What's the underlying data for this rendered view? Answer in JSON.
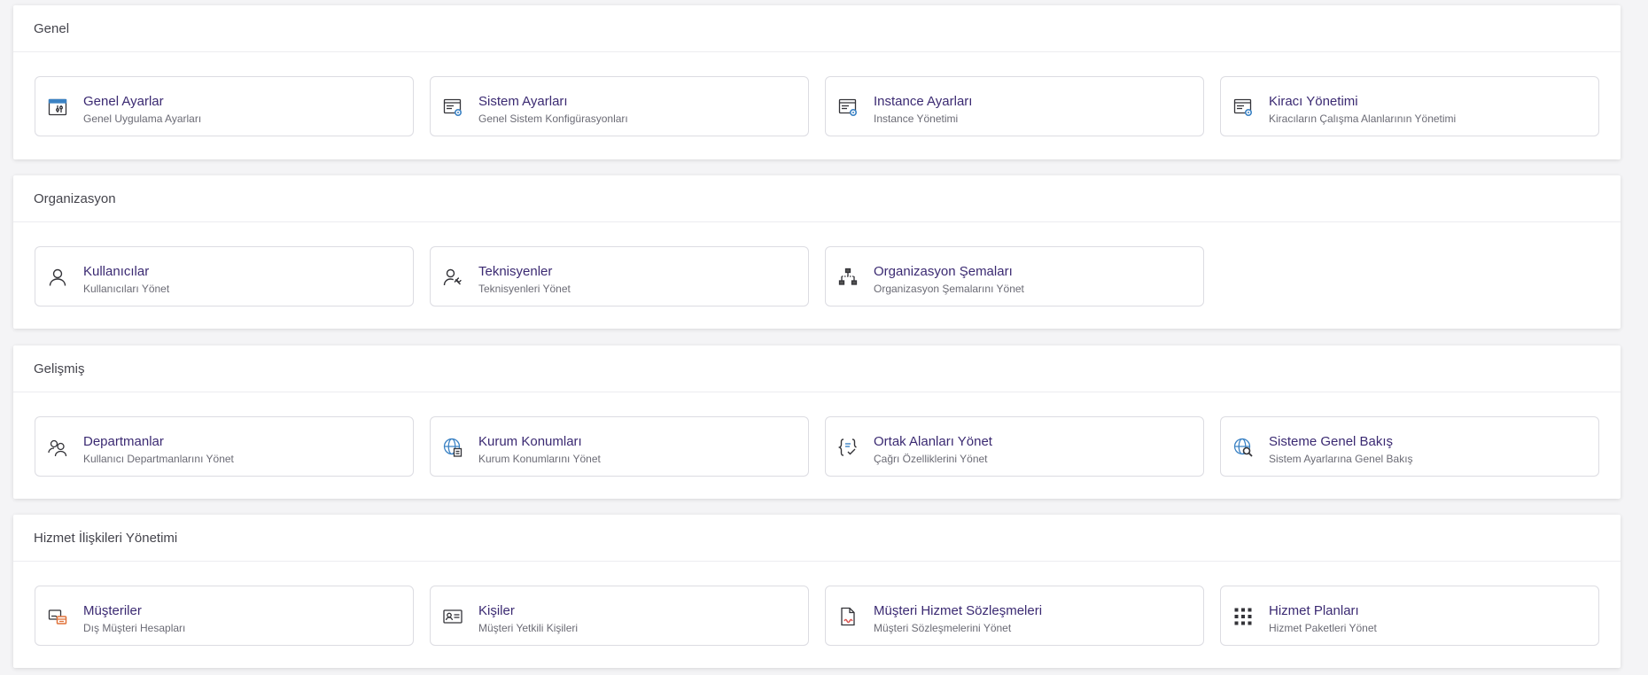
{
  "colors": {
    "accent": "#3b2a72",
    "icon_blue": "#3b82c4",
    "icon_orange": "#e0723a",
    "icon_red": "#d9534f",
    "icon_dark": "#333338"
  },
  "sections": [
    {
      "title": "Genel",
      "cards": [
        {
          "title": "Genel Ayarlar",
          "subtitle": "Genel Uygulama Ayarları",
          "icon": "settings-window-sliders-icon"
        },
        {
          "title": "Sistem Ayarları",
          "subtitle": "Genel Sistem Konfigürasyonları",
          "icon": "window-gear-icon"
        },
        {
          "title": "Instance Ayarları",
          "subtitle": "Instance Yönetimi",
          "icon": "window-gear-icon"
        },
        {
          "title": "Kiracı Yönetimi",
          "subtitle": "Kiracıların Çalışma Alanlarının Yönetimi",
          "icon": "window-gear-icon"
        }
      ]
    },
    {
      "title": "Organizasyon",
      "cards": [
        {
          "title": "Kullanıcılar",
          "subtitle": "Kullanıcıları Yönet",
          "icon": "user-icon"
        },
        {
          "title": "Teknisyenler",
          "subtitle": "Teknisyenleri Yönet",
          "icon": "user-wrench-icon"
        },
        {
          "title": "Organizasyon Şemaları",
          "subtitle": "Organizasyon Şemalarını Yönet",
          "icon": "org-chart-icon"
        }
      ]
    },
    {
      "title": "Gelişmiş",
      "cards": [
        {
          "title": "Departmanlar",
          "subtitle": "Kullanıcı Departmanlarını Yönet",
          "icon": "users-group-icon"
        },
        {
          "title": "Kurum Konumları",
          "subtitle": "Kurum Konumlarını Yönet",
          "icon": "globe-building-icon"
        },
        {
          "title": "Ortak Alanları Yönet",
          "subtitle": "Çağrı Özelliklerini Yönet",
          "icon": "curly-braces-check-icon"
        },
        {
          "title": "Sisteme Genel Bakış",
          "subtitle": "Sistem Ayarlarına Genel Bakış",
          "icon": "globe-search-icon"
        }
      ]
    },
    {
      "title": "Hizmet İlişkileri Yönetimi",
      "cards": [
        {
          "title": "Müşteriler",
          "subtitle": "Dış Müşteri Hesapları",
          "icon": "customer-accounts-icon"
        },
        {
          "title": "Kişiler",
          "subtitle": "Müşteri Yetkili Kişileri",
          "icon": "contact-card-icon"
        },
        {
          "title": "Müşteri Hizmet Sözleşmeleri",
          "subtitle": "Müşteri Sözleşmelerini Yönet",
          "icon": "contract-document-icon"
        },
        {
          "title": "Hizmet Planları",
          "subtitle": "Hizmet Paketleri Yönet",
          "icon": "grid-dots-icon"
        }
      ]
    }
  ]
}
